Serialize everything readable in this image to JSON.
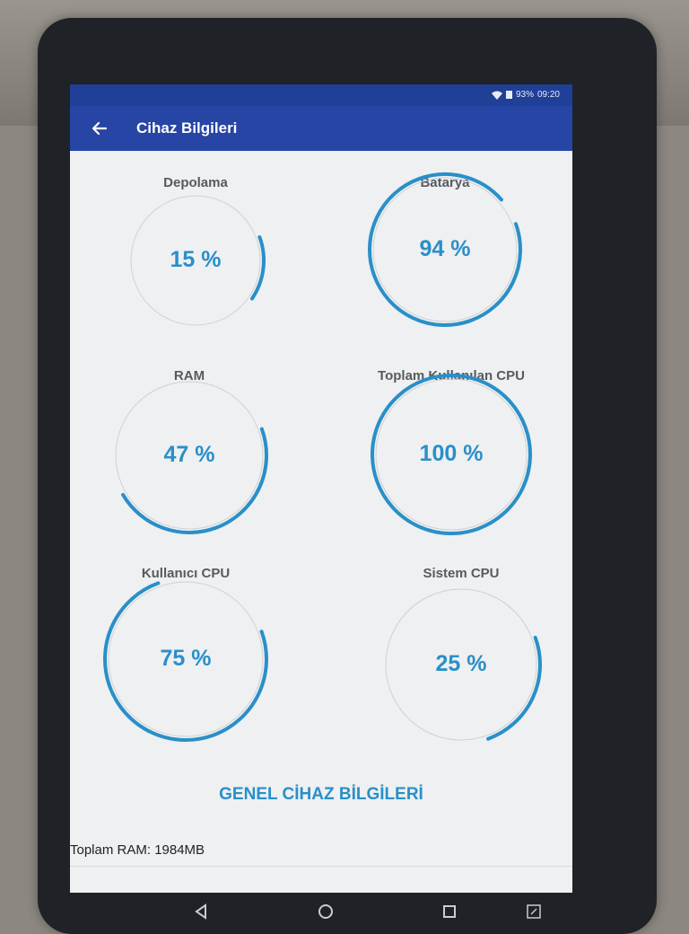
{
  "statusbar": {
    "battery_percent": "93%",
    "time": "09:20"
  },
  "appbar": {
    "title": "Cihaz Bilgileri"
  },
  "gauges": [
    {
      "label": "Depolama",
      "value": "15 %",
      "percent": 15
    },
    {
      "label": "Batarya",
      "value": "94 %",
      "percent": 94
    },
    {
      "label": "RAM",
      "value": "47 %",
      "percent": 47
    },
    {
      "label": "Toplam Kullanılan CPU",
      "value": "100 %",
      "percent": 100
    },
    {
      "label": "Kullanıcı CPU",
      "value": "75 %",
      "percent": 75
    },
    {
      "label": "Sistem CPU",
      "value": "25 %",
      "percent": 25
    }
  ],
  "general_button": "GENEL CİHAZ BİLGİLERİ",
  "total_ram": "Toplam RAM: 1984MB",
  "colors": {
    "appbar": "#2645a4",
    "accent": "#2a8fc9",
    "track": "#cfd2d4"
  },
  "icons": [
    "back-arrow-icon",
    "wifi-icon",
    "signal-icon",
    "nav-back-icon",
    "nav-home-icon",
    "nav-recents-icon",
    "nav-screenshot-icon"
  ]
}
